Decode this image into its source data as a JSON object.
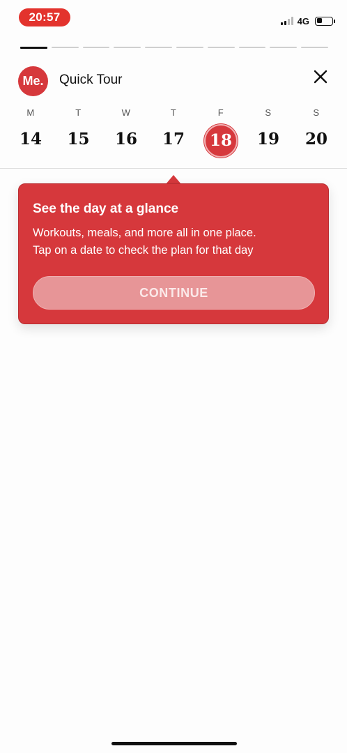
{
  "status_bar": {
    "time": "20:57",
    "network": "4G",
    "signal_bars": 2,
    "battery_level": 0.3
  },
  "progress": {
    "total_steps": 10,
    "current_step": 1
  },
  "header": {
    "logo_text": "Me.",
    "title": "Quick Tour",
    "close_icon": "close-icon"
  },
  "week": {
    "days": [
      {
        "name": "M",
        "date": "14",
        "selected": false
      },
      {
        "name": "T",
        "date": "15",
        "selected": false
      },
      {
        "name": "W",
        "date": "16",
        "selected": false
      },
      {
        "name": "T",
        "date": "17",
        "selected": false
      },
      {
        "name": "F",
        "date": "18",
        "selected": true
      },
      {
        "name": "S",
        "date": "19",
        "selected": false
      },
      {
        "name": "S",
        "date": "20",
        "selected": false
      }
    ]
  },
  "tooltip": {
    "title": "See the day at a glance",
    "line1": "Workouts, meals, and more all in one place.",
    "line2": "Tap on a date to check the plan for that day",
    "button_label": "CONTINUE"
  },
  "colors": {
    "accent": "#d6383c",
    "status_time_bg": "#e3332d",
    "button_bg": "#e79597"
  }
}
